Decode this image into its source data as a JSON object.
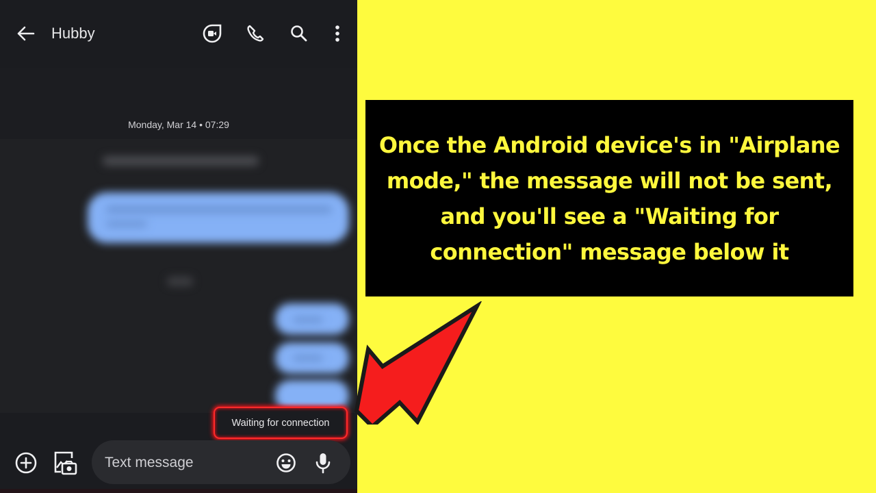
{
  "phone": {
    "header": {
      "title": "Hubby",
      "icons": [
        "back-arrow-icon",
        "video-call-icon",
        "phone-icon",
        "search-icon",
        "more-vert-icon"
      ]
    },
    "conversation": {
      "date_label": "Monday, Mar 14 • 07:29",
      "status_label": "Waiting for connection"
    },
    "composer": {
      "placeholder": "Text message",
      "icons": [
        "add-circle-icon",
        "gallery-icon",
        "emoji-icon",
        "mic-icon"
      ]
    }
  },
  "callout": {
    "text": "Once the Android device's in \"Airplane mode,\" the message will not be sent, and you'll see a \"Waiting for connection\" message below it"
  },
  "colors": {
    "background": "#fefb3e",
    "callout_bg": "#000000",
    "callout_text": "#fef73d",
    "highlight": "#ff2a2a",
    "arrow_fill": "#f51d1d",
    "bubble": "#85b1f6",
    "phone_bg": "#1b1c20"
  }
}
